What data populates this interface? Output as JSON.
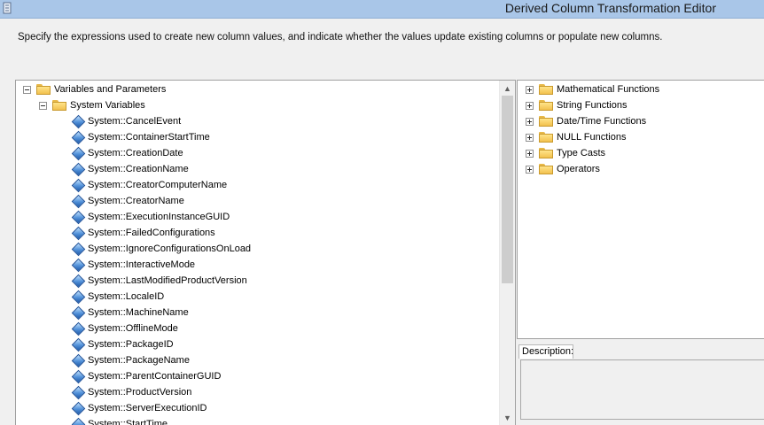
{
  "window": {
    "title": "Derived Column Transformation Editor",
    "icon": "ssis-window-icon"
  },
  "instructions": "Specify the expressions used to create new column values, and indicate whether the values update existing columns or populate new columns.",
  "variables_tree": {
    "root_label": "Variables and Parameters",
    "group_label": "System Variables",
    "items": [
      "System::CancelEvent",
      "System::ContainerStartTime",
      "System::CreationDate",
      "System::CreationName",
      "System::CreatorComputerName",
      "System::CreatorName",
      "System::ExecutionInstanceGUID",
      "System::FailedConfigurations",
      "System::IgnoreConfigurationsOnLoad",
      "System::InteractiveMode",
      "System::LastModifiedProductVersion",
      "System::LocaleID",
      "System::MachineName",
      "System::OfflineMode",
      "System::PackageID",
      "System::PackageName",
      "System::ParentContainerGUID",
      "System::ProductVersion",
      "System::ServerExecutionID",
      "System::StartTime"
    ]
  },
  "functions_tree": {
    "items": [
      "Mathematical Functions",
      "String Functions",
      "Date/Time Functions",
      "NULL Functions",
      "Type Casts",
      "Operators"
    ]
  },
  "description_panel": {
    "tab_label": "Description:"
  }
}
